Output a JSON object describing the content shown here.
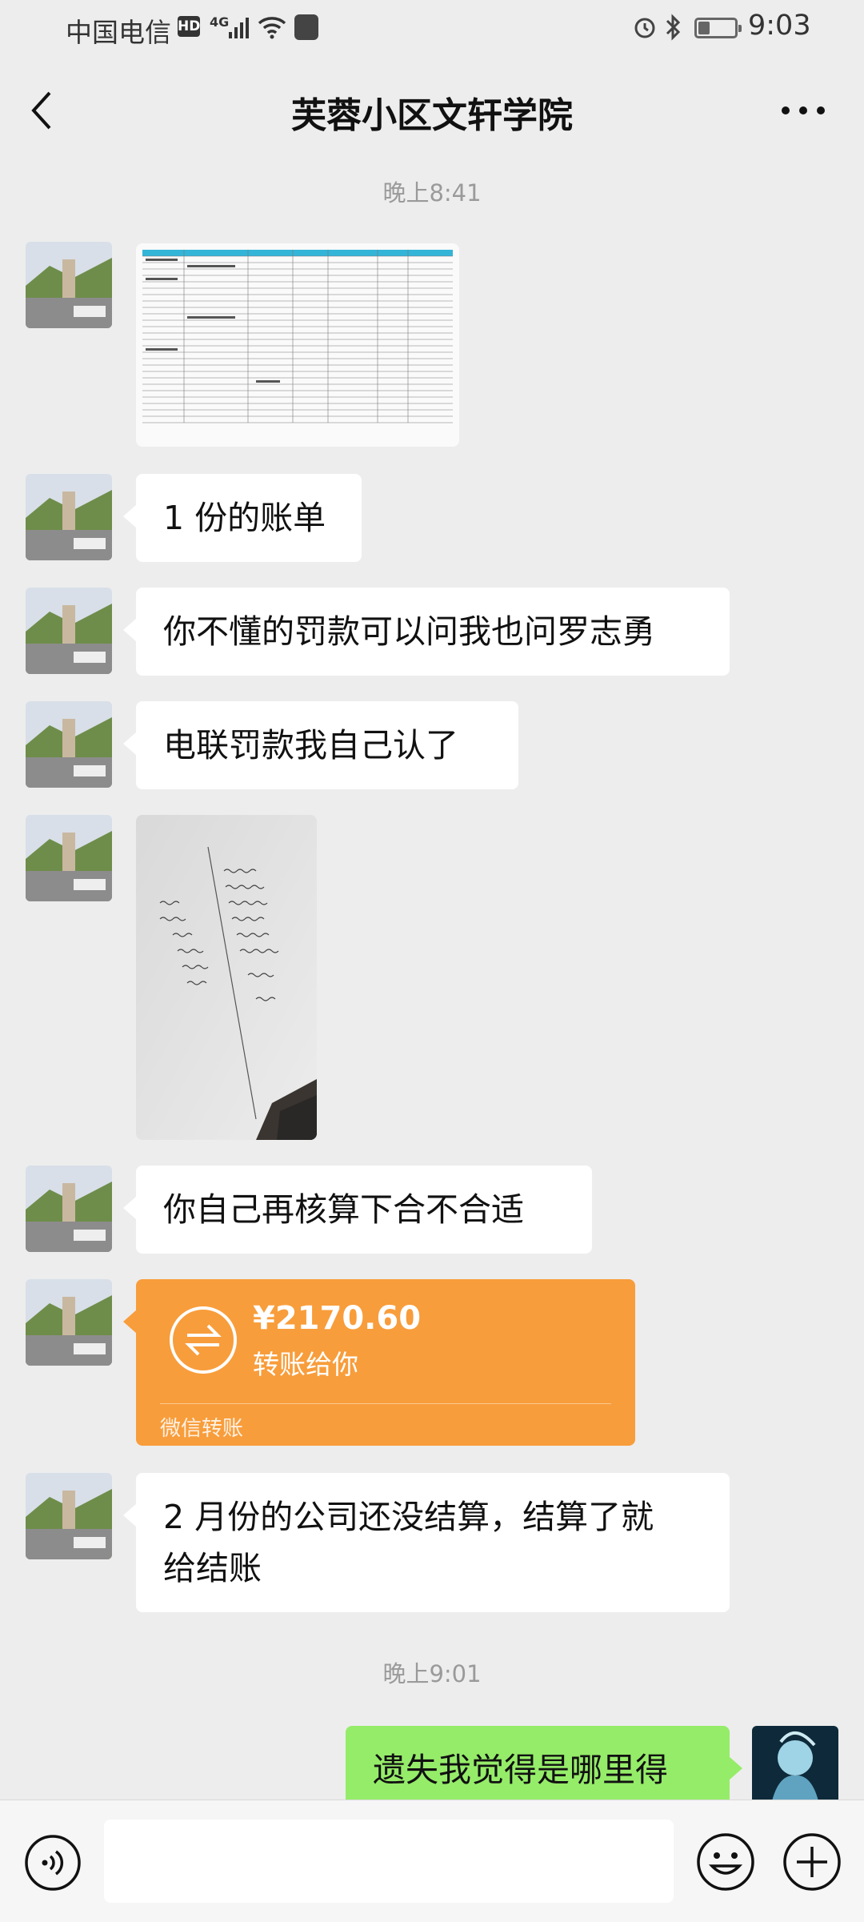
{
  "status_bar": {
    "carrier": "中国电信",
    "hd": "HD",
    "network": "4G",
    "time": "9:03"
  },
  "header": {
    "title": "芙蓉小区文轩学院"
  },
  "messages": [
    {
      "type": "timestamp",
      "text": "晚上8:41"
    },
    {
      "type": "image",
      "side": "left",
      "description": "spreadsheet-screenshot"
    },
    {
      "type": "text",
      "side": "left",
      "text": "1 份的账单"
    },
    {
      "type": "text",
      "side": "left",
      "text": "你不懂的罚款可以问我也问罗志勇"
    },
    {
      "type": "text",
      "side": "left",
      "text": "电联罚款我自己认了"
    },
    {
      "type": "image",
      "side": "left",
      "description": "handwritten-note-photo"
    },
    {
      "type": "text",
      "side": "left",
      "text": "你自己再核算下合不合适"
    },
    {
      "type": "transfer",
      "side": "left",
      "amount": "¥2170.60",
      "desc": "转账给你",
      "footer": "微信转账",
      "color": "#f89d3b"
    },
    {
      "type": "text",
      "side": "left",
      "lines": [
        "2 月份的公司还没结算，结算了就",
        "给结账"
      ]
    },
    {
      "type": "timestamp",
      "text": "晚上9:01"
    },
    {
      "type": "text",
      "side": "right",
      "text": "遗失我觉得是哪里得",
      "color": "#95ec69"
    }
  ],
  "icons": {
    "back": "chevron-left-icon",
    "more": "more-dots-icon",
    "voice": "voice-icon",
    "emoji": "emoji-icon",
    "plus": "plus-icon",
    "transfer": "transfer-arrows-icon"
  }
}
